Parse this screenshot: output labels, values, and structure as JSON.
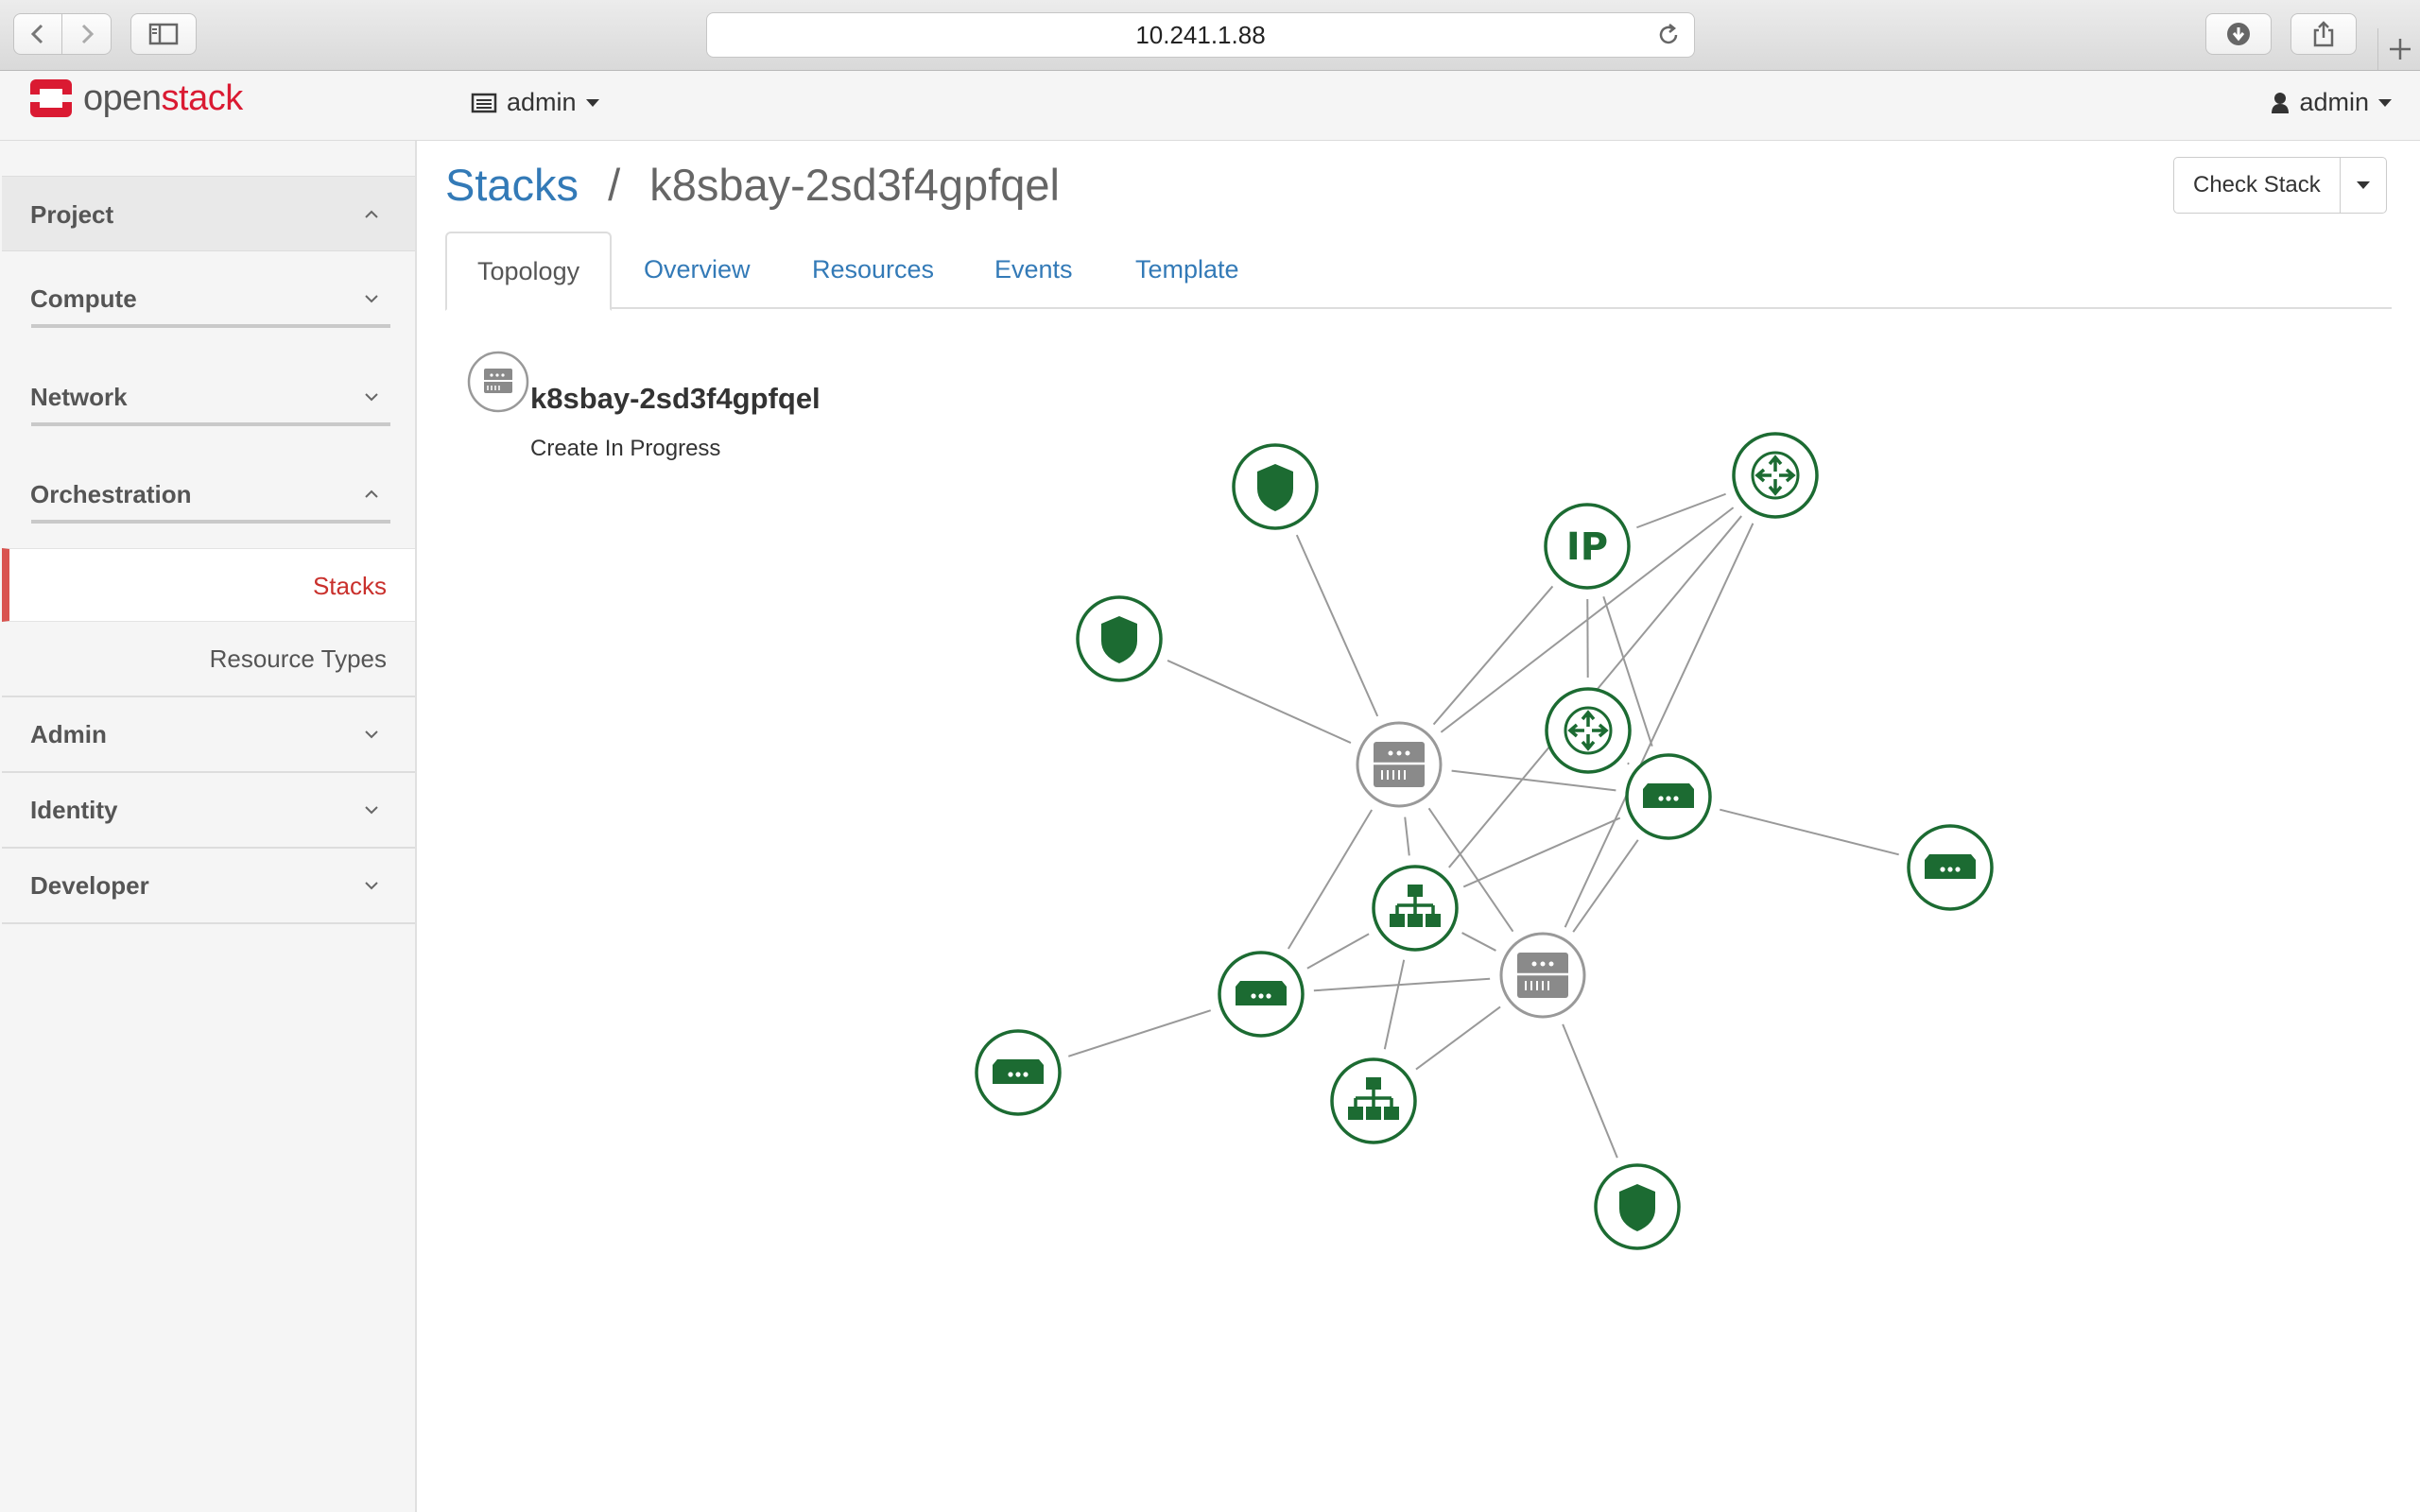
{
  "browser": {
    "url": "10.241.1.88"
  },
  "header": {
    "logo_prefix": "open",
    "logo_suffix": "stack",
    "project_label": "admin",
    "user_label": "admin"
  },
  "sidebar": {
    "sections": [
      {
        "label": "Project",
        "expanded": true
      },
      {
        "label": "Compute",
        "expanded": false
      },
      {
        "label": "Network",
        "expanded": false
      },
      {
        "label": "Orchestration",
        "expanded": true
      },
      {
        "label": "Admin",
        "expanded": false
      },
      {
        "label": "Identity",
        "expanded": false
      },
      {
        "label": "Developer",
        "expanded": false
      }
    ],
    "orchestration_items": [
      {
        "label": "Stacks",
        "active": true
      },
      {
        "label": "Resource Types",
        "active": false
      }
    ]
  },
  "breadcrumb": {
    "parent": "Stacks",
    "separator": "/",
    "current": "k8sbay-2sd3f4gpfqel"
  },
  "actions": {
    "check_stack": "Check Stack"
  },
  "tabs": [
    {
      "label": "Topology",
      "active": true
    },
    {
      "label": "Overview",
      "active": false
    },
    {
      "label": "Resources",
      "active": false
    },
    {
      "label": "Events",
      "active": false
    },
    {
      "label": "Template",
      "active": false
    }
  ],
  "stack": {
    "name": "k8sbay-2sd3f4gpfqel",
    "status": "Create In Progress"
  },
  "topology": {
    "colors": {
      "resource": "#1c6b32",
      "server": "#8a8a8a",
      "edge": "#999999"
    },
    "nodes": [
      {
        "id": "sg1",
        "type": "security-group"
      },
      {
        "id": "sg2",
        "type": "security-group"
      },
      {
        "id": "sg3",
        "type": "security-group"
      },
      {
        "id": "ip",
        "type": "floating-ip",
        "label": "IP"
      },
      {
        "id": "r1",
        "type": "router"
      },
      {
        "id": "r2",
        "type": "router"
      },
      {
        "id": "srv1",
        "type": "server"
      },
      {
        "id": "srv2",
        "type": "server"
      },
      {
        "id": "p1",
        "type": "port"
      },
      {
        "id": "p2",
        "type": "port"
      },
      {
        "id": "p3",
        "type": "port"
      },
      {
        "id": "p4",
        "type": "port"
      },
      {
        "id": "n1",
        "type": "network"
      },
      {
        "id": "n2",
        "type": "network"
      }
    ],
    "edges": [
      [
        "sg1",
        "srv1"
      ],
      [
        "sg2",
        "srv1"
      ],
      [
        "ip",
        "srv1"
      ],
      [
        "ip",
        "r1"
      ],
      [
        "ip",
        "r2"
      ],
      [
        "ip",
        "p1"
      ],
      [
        "r2",
        "p1"
      ],
      [
        "srv1",
        "r1"
      ],
      [
        "srv1",
        "p1"
      ],
      [
        "srv1",
        "n1"
      ],
      [
        "srv1",
        "p2"
      ],
      [
        "srv1",
        "srv2"
      ],
      [
        "r1",
        "srv2"
      ],
      [
        "r1",
        "n1"
      ],
      [
        "p1",
        "n1"
      ],
      [
        "p1",
        "srv2"
      ],
      [
        "p1",
        "p4"
      ],
      [
        "n1",
        "p2"
      ],
      [
        "n1",
        "n2"
      ],
      [
        "n1",
        "srv2"
      ],
      [
        "p2",
        "srv2"
      ],
      [
        "p2",
        "p3"
      ],
      [
        "srv2",
        "n2"
      ],
      [
        "srv2",
        "sg3"
      ]
    ]
  }
}
